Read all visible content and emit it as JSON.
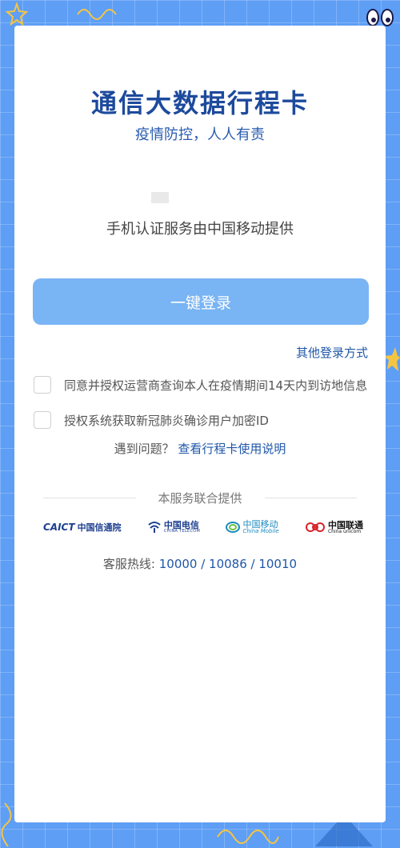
{
  "header": {
    "title": "通信大数据行程卡",
    "subtitle": "疫情防控，人人有责"
  },
  "auth": {
    "provider_text": "手机认证服务由中国移动提供",
    "login_button": "一键登录",
    "other_login": "其他登录方式"
  },
  "agreements": [
    {
      "label": "同意并授权运营商查询本人在疫情期间14天内到访地信息",
      "checked": false
    },
    {
      "label": "授权系统获取新冠肺炎确诊用户加密ID",
      "checked": false
    }
  ],
  "help": {
    "prefix": "遇到问题？",
    "link": "查看行程卡使用说明"
  },
  "partners": {
    "heading": "本服务联合提供",
    "caict_abbr": "CAICT",
    "caict_name": "中国信通院",
    "telecom_name": "中国电信",
    "telecom_en": "CHINA TELECOM",
    "mobile_name": "中国移动",
    "mobile_en": "China Mobile",
    "unicom_name": "中国联通",
    "unicom_en": "China unicom"
  },
  "hotline": {
    "label": "客服热线: ",
    "numbers": "10000 / 10086 / 10010"
  },
  "colors": {
    "background": "#5e9ef5",
    "title": "#1d4a9c",
    "button": "#79b4f4",
    "link": "#1f56a8"
  }
}
